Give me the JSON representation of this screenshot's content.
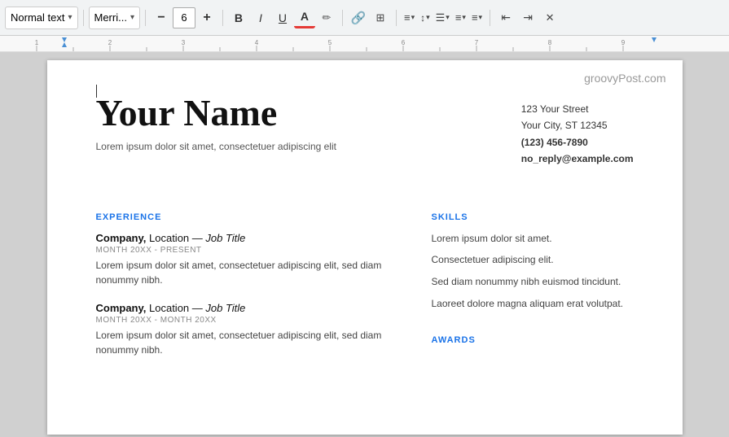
{
  "toolbar": {
    "style_label": "Normal text",
    "font_label": "Merri...",
    "font_size": "6",
    "bold_label": "B",
    "italic_label": "I",
    "underline_label": "U",
    "font_color_label": "A",
    "highlight_label": "A",
    "link_label": "🔗",
    "insert_label": "⊞",
    "align_label": "≡",
    "line_spacing_label": "≡",
    "checklist_label": "☑",
    "bullets_label": "≡",
    "numbering_label": "≡",
    "indent_dec_label": "⇤",
    "indent_inc_label": "⇥",
    "format_clear_label": "✕"
  },
  "watermark": "groovyPost.com",
  "resume": {
    "name": "Your Name",
    "tagline": "Lorem ipsum dolor sit amet, consectetuer adipiscing elit",
    "contact": {
      "street": "123 Your Street",
      "city": "Your City, ST 12345",
      "phone": "(123) 456-7890",
      "email": "no_reply@example.com"
    },
    "sections": {
      "experience_label": "EXPERIENCE",
      "skills_label": "SKILLS",
      "awards_label": "AWARDS"
    },
    "jobs": [
      {
        "company": "Company,",
        "location_title": " Location — ",
        "job_title": "Job Title",
        "dates": "MONTH 20XX - PRESENT",
        "description": "Lorem ipsum dolor sit amet, consectetuer adipiscing elit, sed diam nonummy nibh."
      },
      {
        "company": "Company,",
        "location_title": " Location — ",
        "job_title": "Job Title",
        "dates": "MONTH 20XX - MONTH 20XX",
        "description": "Lorem ipsum dolor sit amet, consectetuer adipiscing elit, sed diam nonummy nibh."
      }
    ],
    "skills": [
      "Lorem ipsum dolor sit amet.",
      "Consectetuer adipiscing elit.",
      "Sed diam nonummy nibh euismod tincidunt.",
      "Laoreet dolore magna aliquam erat volutpat."
    ]
  }
}
